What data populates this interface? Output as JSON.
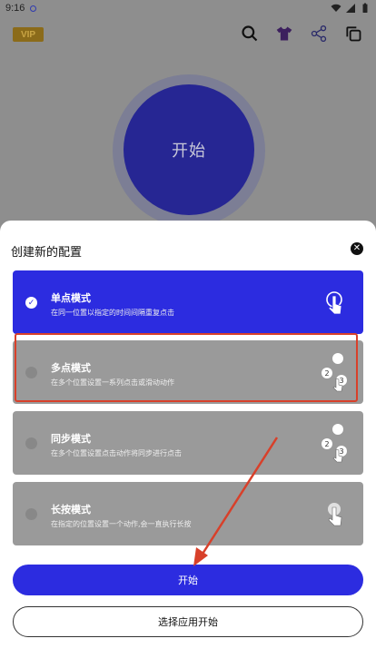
{
  "status_bar": {
    "time": "9:16"
  },
  "header": {
    "vip_label": "VIP"
  },
  "main": {
    "start_circle_label": "开始"
  },
  "sheet": {
    "title": "创建新的配置",
    "modes": [
      {
        "title": "单点模式",
        "desc": "在同一位置以指定的时间间隔重复点击",
        "selected": true
      },
      {
        "title": "多点模式",
        "desc": "在多个位置设置一系列点击或滑动动作",
        "selected": false
      },
      {
        "title": "同步模式",
        "desc": "在多个位置设置点击动作将同步进行点击",
        "selected": false
      },
      {
        "title": "长按模式",
        "desc": "在指定的位置设置一个动作,会一直执行长按",
        "selected": false
      }
    ],
    "start_button": "开始",
    "choose_app_button": "选择应用开始"
  },
  "icons": {
    "search": "search-icon",
    "shirt": "shirt-icon",
    "share": "share-icon",
    "copy": "copy-icon",
    "close": "close-icon",
    "check": "check-icon",
    "single_tap": "single-tap-icon",
    "multi_tap": "multi-tap-icon",
    "sync_tap": "sync-tap-icon",
    "long_press": "long-press-icon"
  },
  "colors": {
    "accent": "#2c2ce0",
    "highlight": "#d8402a",
    "vip_bg": "#8b6b1a",
    "vip_text": "#c9a545"
  }
}
